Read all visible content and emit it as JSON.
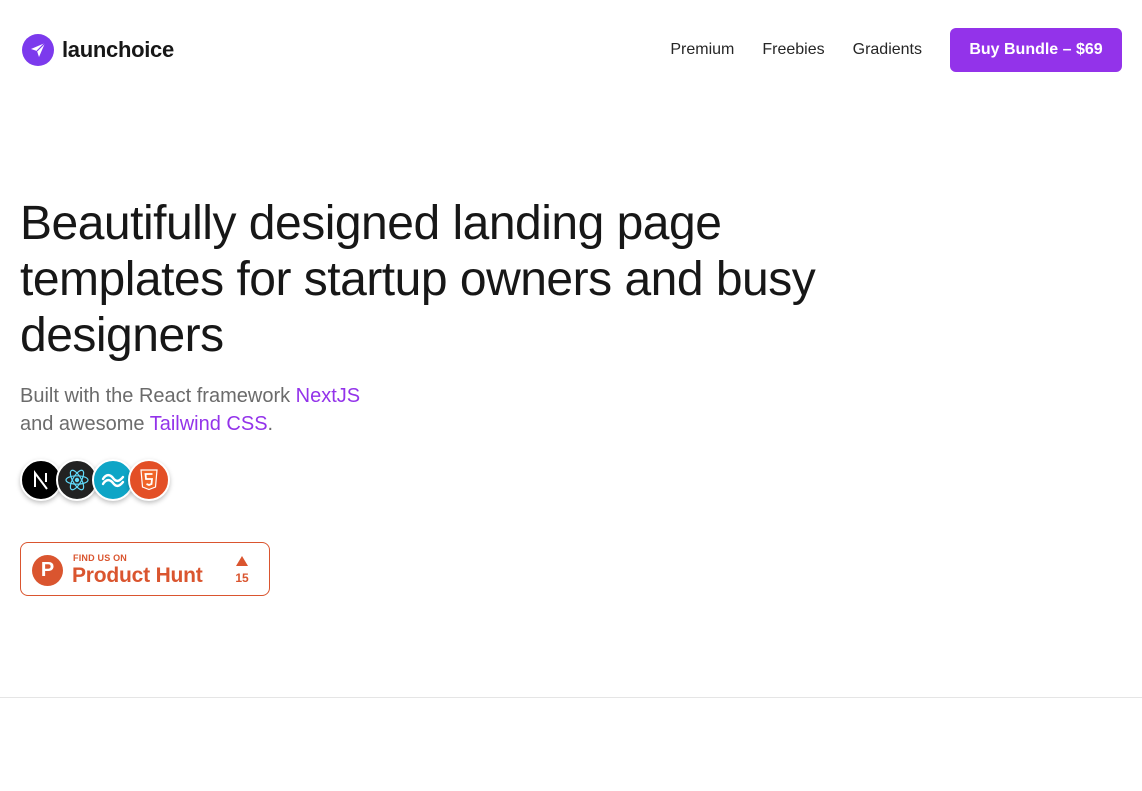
{
  "header": {
    "brand": "launchoice",
    "nav": [
      {
        "label": "Premium"
      },
      {
        "label": "Freebies"
      },
      {
        "label": "Gradients"
      }
    ],
    "cta_label": "Buy Bundle – $69"
  },
  "hero": {
    "title": "Beautifully designed landing page templates for startup owners and busy designers",
    "subtitle": {
      "part1": "Built with the React framework ",
      "link1": "NextJS",
      "part2": "and awesome ",
      "link2": "Tailwind CSS",
      "part3": "."
    },
    "tech_icons": [
      "nextjs-icon",
      "react-icon",
      "tailwind-icon",
      "html5-icon"
    ]
  },
  "product_hunt": {
    "small_label": "FIND US ON",
    "big_label": "Product Hunt",
    "votes": "15",
    "letter": "P"
  },
  "colors": {
    "accent": "#9333ea",
    "logo": "#7c3aed",
    "product_hunt": "#da552f",
    "title": "#171717",
    "subtitle": "#6b6b6b"
  }
}
